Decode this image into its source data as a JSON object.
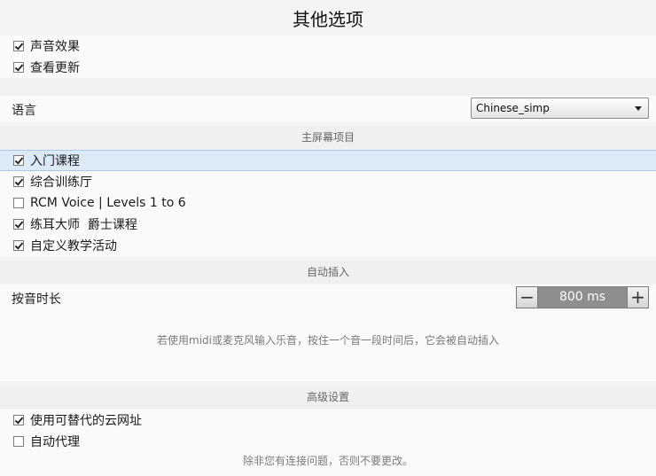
{
  "title": "其他选项",
  "general": [
    {
      "label": "声音效果",
      "checked": true
    },
    {
      "label": "查看更新",
      "checked": true
    }
  ],
  "language": {
    "label": "语言",
    "selected": "Chinese_simp"
  },
  "home_screen": {
    "header": "主屏幕项目",
    "items": [
      {
        "label": "入门课程",
        "checked": true,
        "selected": true
      },
      {
        "label": "综合训练厅",
        "checked": true
      },
      {
        "label": "RCM Voice | Levels 1 to 6",
        "checked": false
      },
      {
        "label": "练耳大师  爵士课程",
        "checked": true
      },
      {
        "label": "自定义教学活动",
        "checked": true
      }
    ]
  },
  "auto_insert": {
    "header": "自动插入",
    "duration_label": "按音时长",
    "duration_value": "800 ms",
    "minus": "−",
    "plus": "+",
    "hint": "若使用midi或麦克风输入乐音，按住一个音一段时间后，它会被自动插入"
  },
  "advanced": {
    "header": "高级设置",
    "items": [
      {
        "label": "使用可替代的云网址",
        "checked": true
      },
      {
        "label": "自动代理",
        "checked": false
      }
    ],
    "hint": "除非您有连接问题，否则不要更改。"
  }
}
